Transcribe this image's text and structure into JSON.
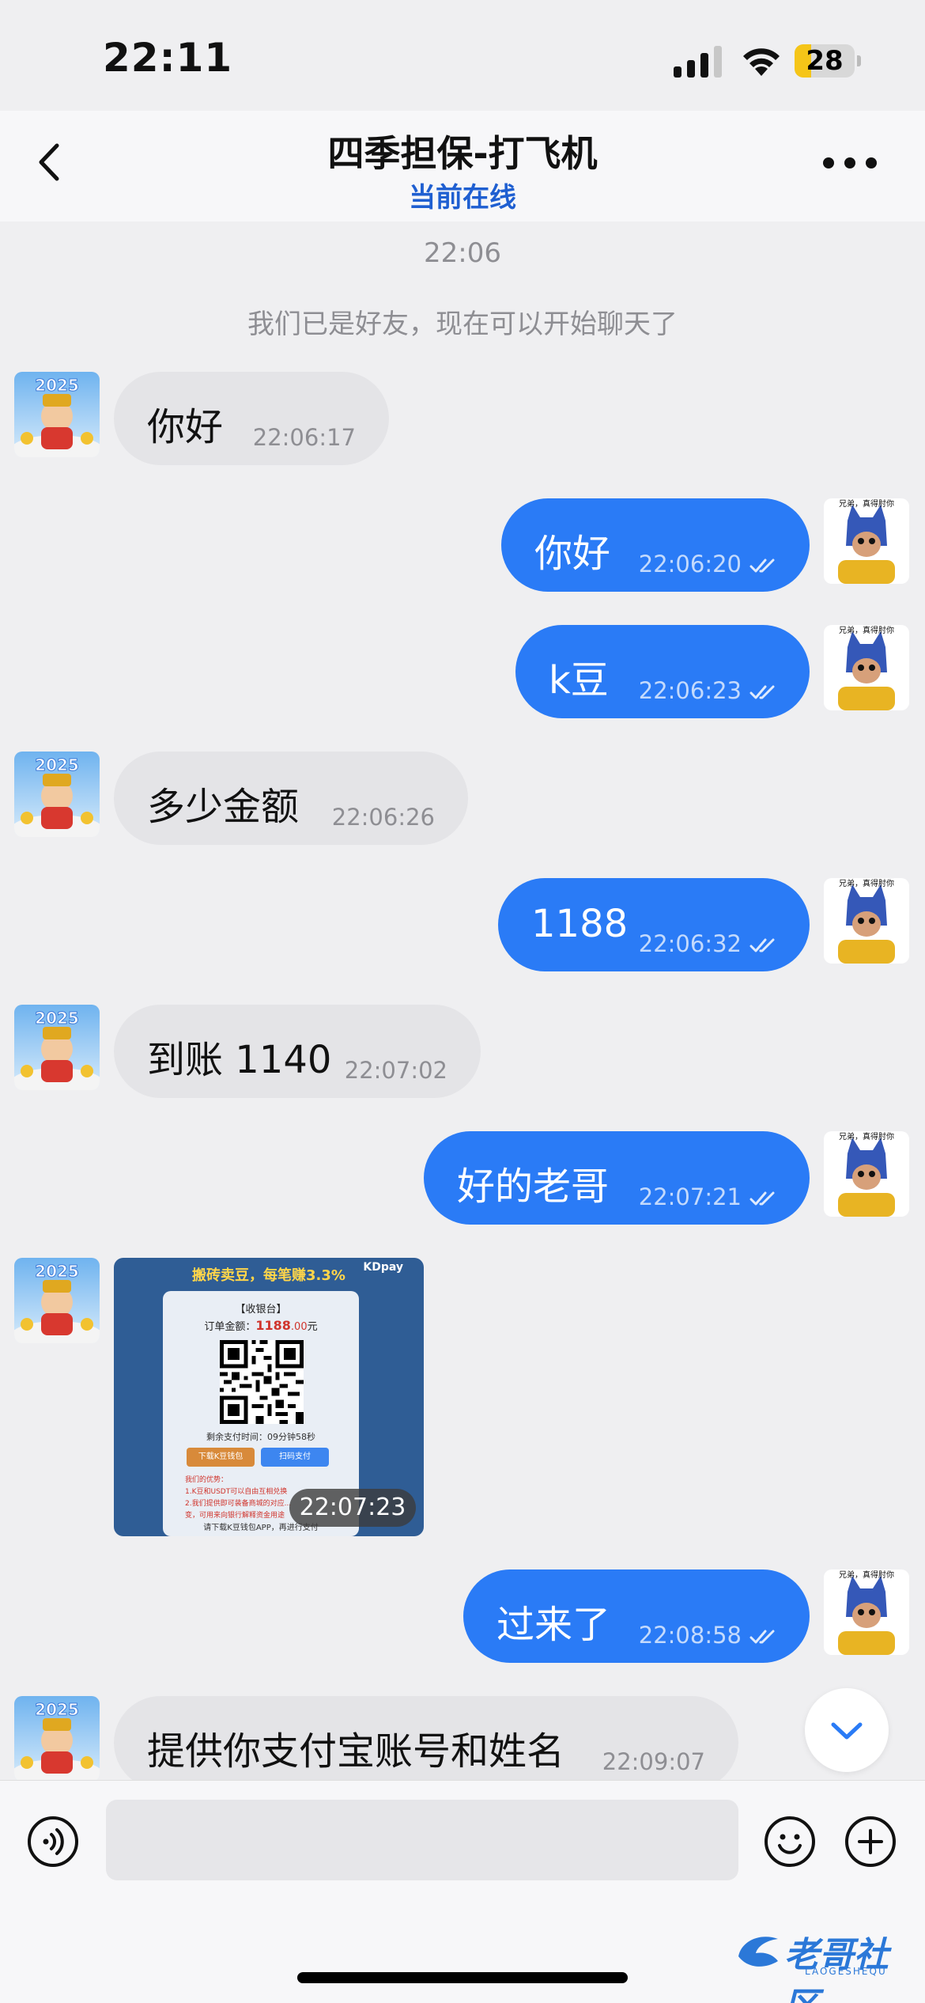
{
  "status_bar": {
    "time": "22:11",
    "battery_level": "28",
    "battery_fraction": 0.28
  },
  "header": {
    "title": "四季担保-打飞机",
    "subtitle": "当前在线"
  },
  "chat": {
    "time_separator": "22:06",
    "system_notice": "我们已是好友，现在可以开始聊天了",
    "messages": [
      {
        "direction": "in",
        "text": "你好",
        "time": "22:06:17"
      },
      {
        "direction": "out",
        "text": "你好",
        "time": "22:06:20",
        "read": true
      },
      {
        "direction": "out",
        "text": "k豆",
        "time": "22:06:23",
        "read": true
      },
      {
        "direction": "in",
        "text": "多少金额",
        "time": "22:06:26"
      },
      {
        "direction": "out",
        "text": "1188",
        "time": "22:06:32",
        "read": true
      },
      {
        "direction": "in",
        "text": "到账 1140",
        "time": "22:07:02"
      },
      {
        "direction": "out",
        "text": "好的老哥",
        "time": "22:07:21",
        "read": true
      },
      {
        "direction": "in",
        "type": "image",
        "time": "22:07:23"
      },
      {
        "direction": "out",
        "text": "过来了",
        "time": "22:08:58",
        "read": true
      },
      {
        "direction": "in",
        "text": "提供你支付宝账号和姓名",
        "time": "22:09:07"
      }
    ],
    "my_avatar_caption": "兄弟，真得肘你",
    "contact_avatar_caption": "2025",
    "image_content": {
      "promo": "搬砖卖豆，每笔赚3.3%",
      "brand": "KDpay",
      "card_title": "【收银台】",
      "amount_label": "订单金额：",
      "amount_value": "1188",
      "amount_cents": ".00",
      "amount_unit": "元",
      "remaining": "剩余支付时间：09分钟58秒",
      "download_button": "下载K豆钱包",
      "scan_button": "扫码支付",
      "advantages": "我们的优势：\n1.K豆和USDT可以自由互相兑换\n2.我们提供即可装备商城的对应...\n变，可用来向银行解释资金用途",
      "download_tip": "请下载K豆钱包APP，再进行支付"
    }
  },
  "input_bar": {
    "placeholder": ""
  },
  "watermark": {
    "text": "老哥社区",
    "sub": "LAOGESHEQU"
  },
  "colors": {
    "outgoing_bubble": "#2a7bf6",
    "incoming_bubble": "#e4e4e7",
    "status_online": "#1f5fd1"
  }
}
